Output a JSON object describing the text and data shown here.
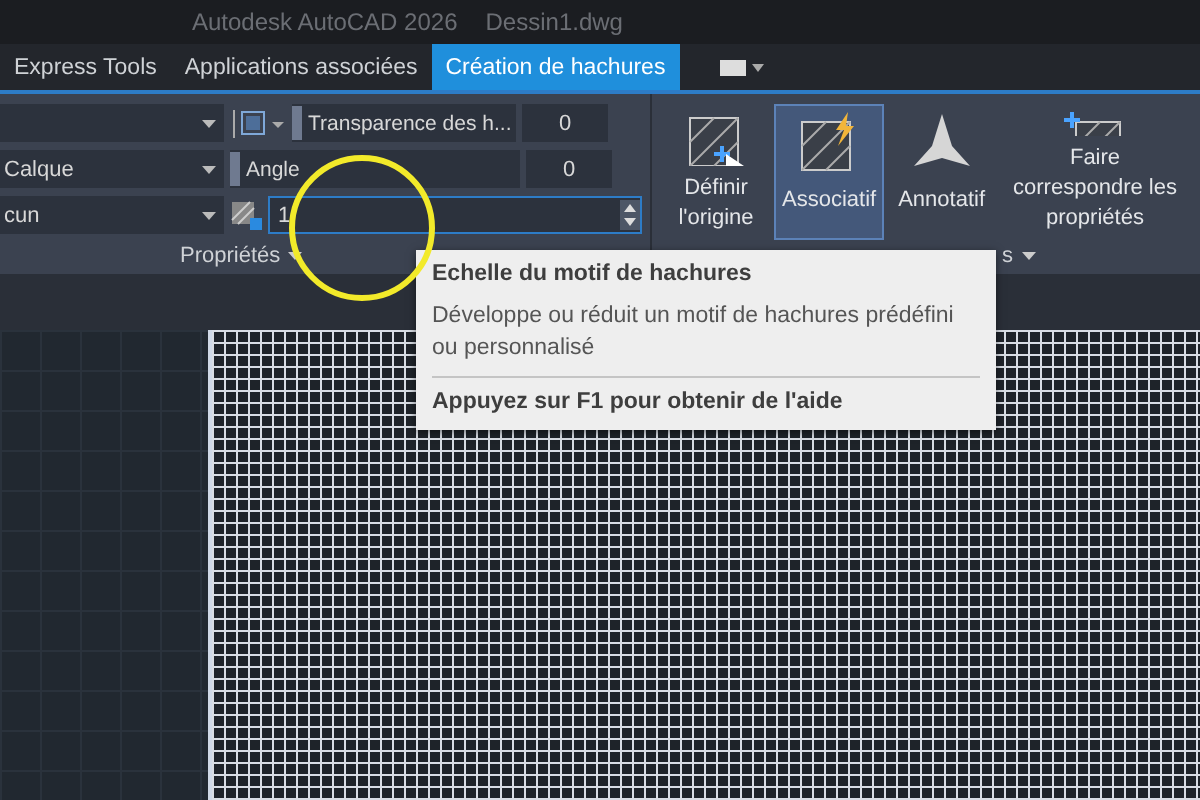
{
  "window": {
    "title": "Autodesk AutoCAD 2026",
    "file": "Dessin1.dwg"
  },
  "tabs": [
    {
      "label": "Express Tools",
      "selected": false
    },
    {
      "label": "Applications associées",
      "selected": false
    },
    {
      "label": "Création de hachures",
      "selected": true
    }
  ],
  "properties_panel": {
    "rows": [
      {
        "dropdown": "",
        "field": "Transparence des h...",
        "value": "0"
      },
      {
        "dropdown": "Calque",
        "field": "Angle",
        "value": "0"
      },
      {
        "dropdown": "cun",
        "field": "",
        "value": "1"
      }
    ],
    "label": "Propriétés"
  },
  "buttons": [
    {
      "label": "Définir l'origine",
      "kind": "origin",
      "selected": false
    },
    {
      "label": "Associatif",
      "kind": "associative",
      "selected": true
    },
    {
      "label": "Annotatif",
      "kind": "annotative",
      "selected": false
    },
    {
      "label": "Faire correspondre les propriétés",
      "kind": "match",
      "selected": false
    }
  ],
  "options_label": "s",
  "tooltip": {
    "title": "Echelle du motif de hachures",
    "description": "Développe ou réduit un motif de hachures prédéfini ou personnalisé",
    "help": "Appuyez sur F1 pour obtenir de l'aide"
  }
}
